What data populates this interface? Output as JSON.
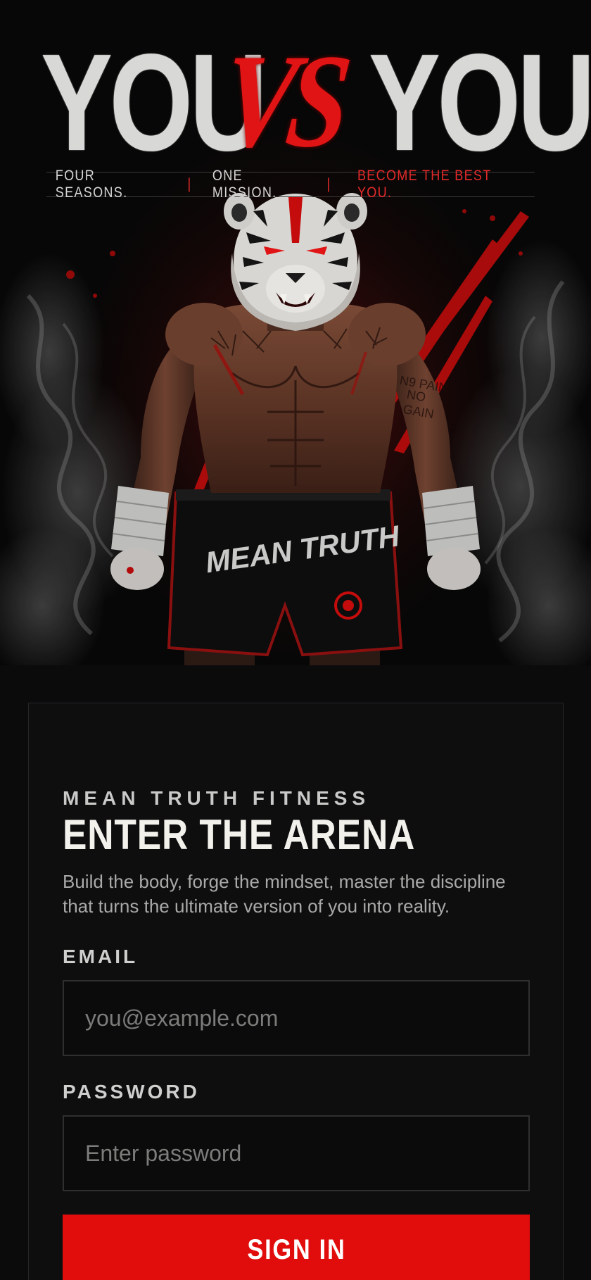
{
  "hero": {
    "headline_left": "YOU",
    "headline_vs": "VS",
    "headline_right": "YOU",
    "tagline": {
      "part1": "FOUR SEASONS.",
      "part2": "ONE MISSION.",
      "part3": "BECOME THE BEST YOU.",
      "separator": "|"
    },
    "image_subject": "tiger-fighter",
    "shorts_text": "MEAN TRUTH",
    "arm_tattoo_text": "NO PAIN NO GAIN"
  },
  "form": {
    "brand": "MEAN TRUTH FITNESS",
    "title": "ENTER THE ARENA",
    "description": "Build the body, forge the mindset, master the discipline that turns the ultimate version of you into reality.",
    "email_label": "EMAIL",
    "email_placeholder": "you@example.com",
    "email_value": "",
    "password_label": "PASSWORD",
    "password_placeholder": "Enter password",
    "password_value": "",
    "submit_label": "SIGN IN"
  },
  "colors": {
    "accent": "#e10c0c",
    "background": "#0b0b0c",
    "card": "#0e0e0f",
    "headline_gray": "#d8d8d6"
  }
}
